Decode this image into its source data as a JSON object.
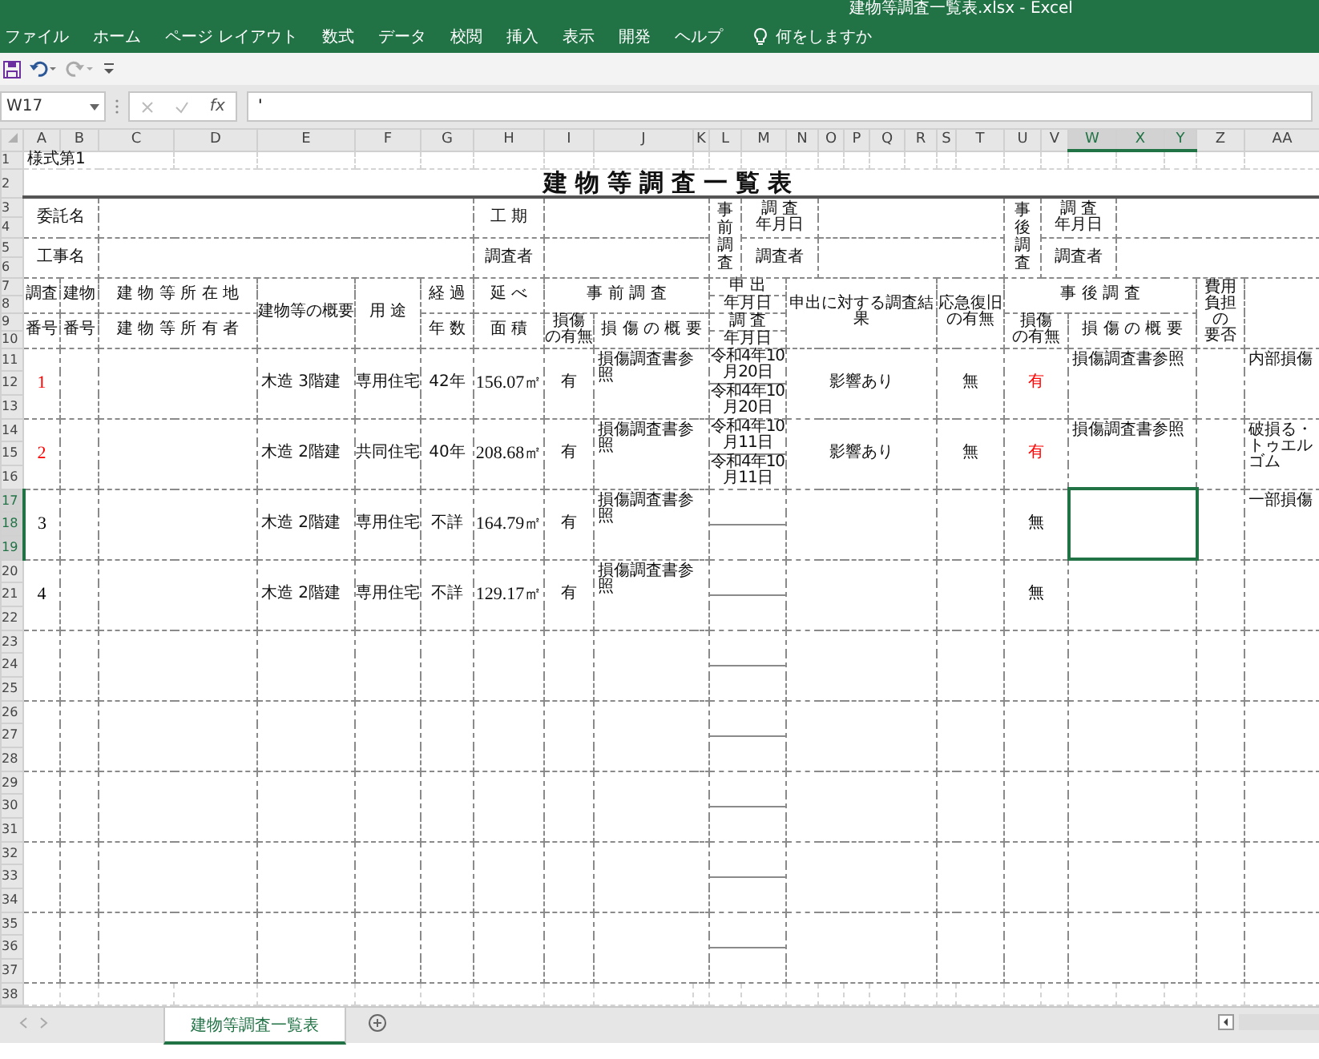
{
  "window": {
    "title": "建物等調査一覧表.xlsx  -  Excel"
  },
  "menu": [
    {
      "label": "ファイル"
    },
    {
      "label": "ホーム"
    },
    {
      "label": "ページ レイアウト"
    },
    {
      "label": "数式"
    },
    {
      "label": "データ"
    },
    {
      "label": "校閲"
    },
    {
      "label": "挿入"
    },
    {
      "label": "表示"
    },
    {
      "label": "開発"
    },
    {
      "label": "ヘルプ"
    }
  ],
  "tell_me": {
    "label": "何をしますか"
  },
  "formula_bar": {
    "name_box": "W17",
    "function_label": "fx",
    "value": "'"
  },
  "column_headers": [
    {
      "label": "A",
      "selected": false
    },
    {
      "label": "B",
      "selected": false
    },
    {
      "label": "C",
      "selected": false
    },
    {
      "label": "D",
      "selected": false
    },
    {
      "label": "E",
      "selected": false
    },
    {
      "label": "F",
      "selected": false
    },
    {
      "label": "G",
      "selected": false
    },
    {
      "label": "H",
      "selected": false
    },
    {
      "label": "I",
      "selected": false
    },
    {
      "label": "J",
      "selected": false
    },
    {
      "label": "K",
      "selected": false
    },
    {
      "label": "L",
      "selected": false
    },
    {
      "label": "M",
      "selected": false
    },
    {
      "label": "N",
      "selected": false
    },
    {
      "label": "O",
      "selected": false
    },
    {
      "label": "P",
      "selected": false
    },
    {
      "label": "Q",
      "selected": false
    },
    {
      "label": "R",
      "selected": false
    },
    {
      "label": "S",
      "selected": false
    },
    {
      "label": "T",
      "selected": false
    },
    {
      "label": "U",
      "selected": false
    },
    {
      "label": "V",
      "selected": false
    },
    {
      "label": "W",
      "selected": true
    },
    {
      "label": "X",
      "selected": true
    },
    {
      "label": "Y",
      "selected": true
    },
    {
      "label": "Z",
      "selected": false
    },
    {
      "label": "AA",
      "selected": false
    }
  ],
  "row_headers": [
    {
      "label": "1",
      "selected": false
    },
    {
      "label": "2",
      "selected": false
    },
    {
      "label": "3",
      "selected": false
    },
    {
      "label": "4",
      "selected": false
    },
    {
      "label": "5",
      "selected": false
    },
    {
      "label": "6",
      "selected": false
    },
    {
      "label": "7",
      "selected": false
    },
    {
      "label": "8",
      "selected": false
    },
    {
      "label": "9",
      "selected": false
    },
    {
      "label": "10",
      "selected": false
    },
    {
      "label": "11",
      "selected": false
    },
    {
      "label": "12",
      "selected": false
    },
    {
      "label": "13",
      "selected": false
    },
    {
      "label": "14",
      "selected": false
    },
    {
      "label": "15",
      "selected": false
    },
    {
      "label": "16",
      "selected": false
    },
    {
      "label": "17",
      "selected": true
    },
    {
      "label": "18",
      "selected": true
    },
    {
      "label": "19",
      "selected": true
    },
    {
      "label": "20",
      "selected": false
    },
    {
      "label": "21",
      "selected": false
    },
    {
      "label": "22",
      "selected": false
    },
    {
      "label": "23",
      "selected": false
    },
    {
      "label": "24",
      "selected": false
    },
    {
      "label": "25",
      "selected": false
    },
    {
      "label": "26",
      "selected": false
    },
    {
      "label": "27",
      "selected": false
    },
    {
      "label": "28",
      "selected": false
    },
    {
      "label": "29",
      "selected": false
    },
    {
      "label": "30",
      "selected": false
    },
    {
      "label": "31",
      "selected": false
    },
    {
      "label": "32",
      "selected": false
    },
    {
      "label": "33",
      "selected": false
    },
    {
      "label": "34",
      "selected": false
    },
    {
      "label": "35",
      "selected": false
    },
    {
      "label": "36",
      "selected": false
    },
    {
      "label": "37",
      "selected": false
    },
    {
      "label": "38",
      "selected": false
    }
  ],
  "sheet": {
    "form_label": "様式第1",
    "title": "建物等調査一覧表",
    "headers": {
      "client": "委託名",
      "work": "工事名",
      "period": "工 期",
      "surveyor": "調査者",
      "pre_survey": "事前調査",
      "pre_date": [
        "調 査",
        "年月日"
      ],
      "pre_surveyor": "調査者",
      "post_survey": "事後調査",
      "post_date": [
        "調 査",
        "年月日"
      ],
      "post_surveyor": "調査者",
      "survey_no_top": "調査",
      "survey_no_bottom": "番号",
      "building_no_top": "建物",
      "building_no_bottom": "番号",
      "location": "建 物 等 所 在 地",
      "owner": "建 物 等 所 有 者",
      "overview": "建物等の概要",
      "use": "用 途",
      "elapsed_top": "経 過",
      "elapsed_bottom": "年 数",
      "floor_top": "延 べ",
      "floor_bottom": "面 積",
      "pre_group": "事 前 調 査",
      "pre_damage": [
        "損傷",
        "の有無"
      ],
      "pre_summary": "損 傷 の 概 要",
      "request_date_top": "申 出",
      "request_date_bottom": "年月日",
      "survey_date_top": "調 査",
      "survey_date_bottom": "年月日",
      "result": "申出に対する調査結果",
      "emergency": [
        "応急復旧",
        "の有無"
      ],
      "post_group": "事 後 調 査",
      "post_damage": [
        "損傷",
        "の有無"
      ],
      "post_summary": "損 傷 の 概 要",
      "cost": [
        "費用",
        "負担",
        "の",
        "要否"
      ]
    },
    "records": [
      {
        "number": "1",
        "color": "#ff0000",
        "structure": "木造 3階建",
        "use": "専用住宅",
        "age": "42年",
        "floor_area": "156.07㎡",
        "pre_damage": "有",
        "pre_summary": "損傷調査書参照",
        "request_date": "令和4年10月20日",
        "survey_date": "令和4年10月20日",
        "result": "影響あり",
        "emergency": "無",
        "post_damage": {
          "text": "有",
          "color": "#ff0000"
        },
        "post_summary": "損傷調査書参照",
        "note": "内部損傷",
        "selected": false
      },
      {
        "number": "2",
        "color": "#ff0000",
        "structure": "木造 2階建",
        "use": "共同住宅",
        "age": "40年",
        "floor_area": "208.68㎡",
        "pre_damage": "有",
        "pre_summary": "損傷調査書参照",
        "request_date": "令和4年10月11日",
        "survey_date": "令和4年10月11日",
        "result": "影響あり",
        "emergency": "無",
        "post_damage": {
          "text": "有",
          "color": "#ff0000"
        },
        "post_summary": "損傷調査書参照",
        "note": "破損る・トゥエルゴム",
        "selected": false
      },
      {
        "number": "3",
        "color": "#000000",
        "structure": "木造 2階建",
        "use": "専用住宅",
        "age": "不詳",
        "floor_area": "164.79㎡",
        "pre_damage": "有",
        "pre_summary": "損傷調査書参照",
        "post_damage": {
          "text": "無",
          "color": "#000000"
        },
        "note": "一部損傷",
        "selected": true
      },
      {
        "number": "4",
        "color": "#000000",
        "structure": "木造 2階建",
        "use": "専用住宅",
        "age": "不詳",
        "floor_area": "129.17㎡",
        "pre_damage": "有",
        "pre_summary": "損傷調査書参照",
        "post_damage": {
          "text": "無",
          "color": "#000000"
        },
        "selected": false
      }
    ]
  },
  "sheet_tabs": [
    {
      "label": "建物等調査一覧表",
      "selected": true
    }
  ]
}
